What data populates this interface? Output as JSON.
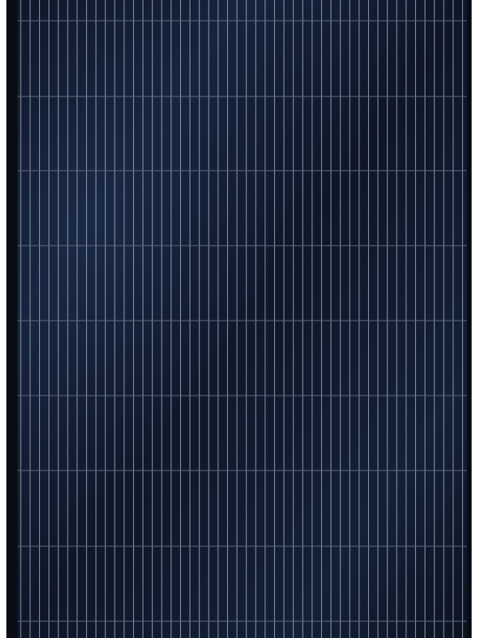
{
  "scene": {
    "subject": "solar-panel",
    "cell_style": "monocrystalline-black",
    "colors": {
      "background": "#ffffff",
      "frame": "#0a0d14",
      "cell_base": "#0f1729",
      "cell_highlight": "#1a2a48",
      "cell_shadow": "#0b111f",
      "gridline": "#b9c4d6",
      "busbar": "#5f6b80"
    }
  }
}
